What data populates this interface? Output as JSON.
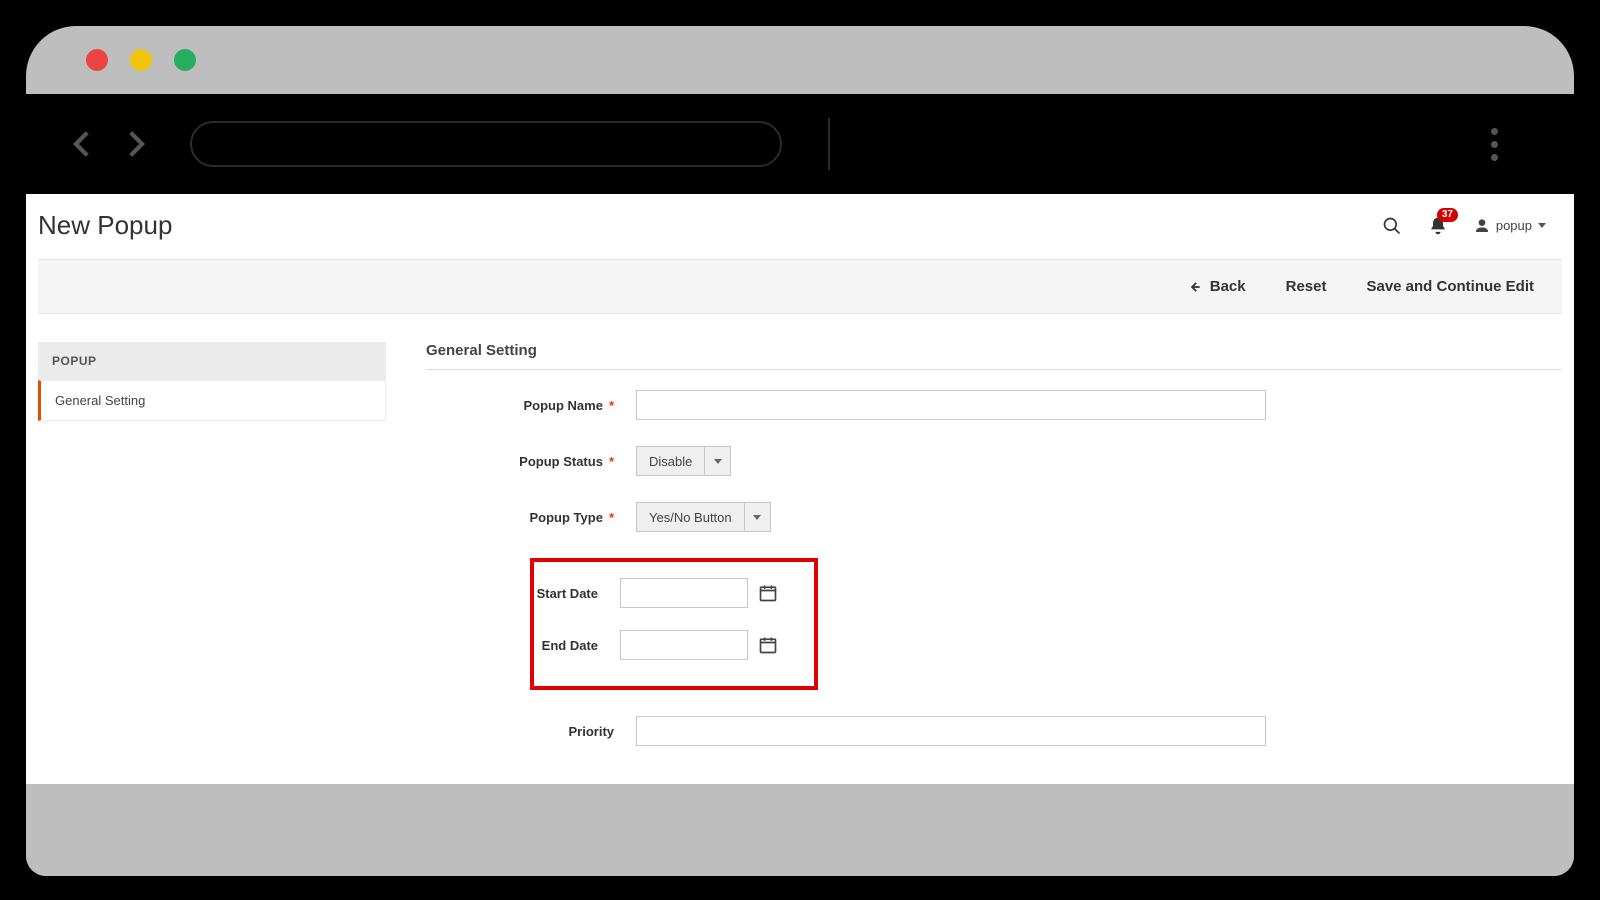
{
  "page": {
    "title": "New Popup"
  },
  "header": {
    "notification_count": "37",
    "user_label": "popup"
  },
  "actions": {
    "back": "Back",
    "reset": "Reset",
    "save_continue": "Save and Continue Edit"
  },
  "sidebar": {
    "group": "POPUP",
    "items": [
      "General Setting"
    ]
  },
  "section": {
    "title": "General Setting"
  },
  "fields": {
    "popup_name": {
      "label": "Popup Name",
      "value": "",
      "required": true
    },
    "popup_status": {
      "label": "Popup Status",
      "value": "Disable",
      "required": true
    },
    "popup_type": {
      "label": "Popup Type",
      "value": "Yes/No Button",
      "required": true
    },
    "start_date": {
      "label": "Start Date",
      "value": ""
    },
    "end_date": {
      "label": "End Date",
      "value": ""
    },
    "priority": {
      "label": "Priority",
      "value": ""
    }
  }
}
